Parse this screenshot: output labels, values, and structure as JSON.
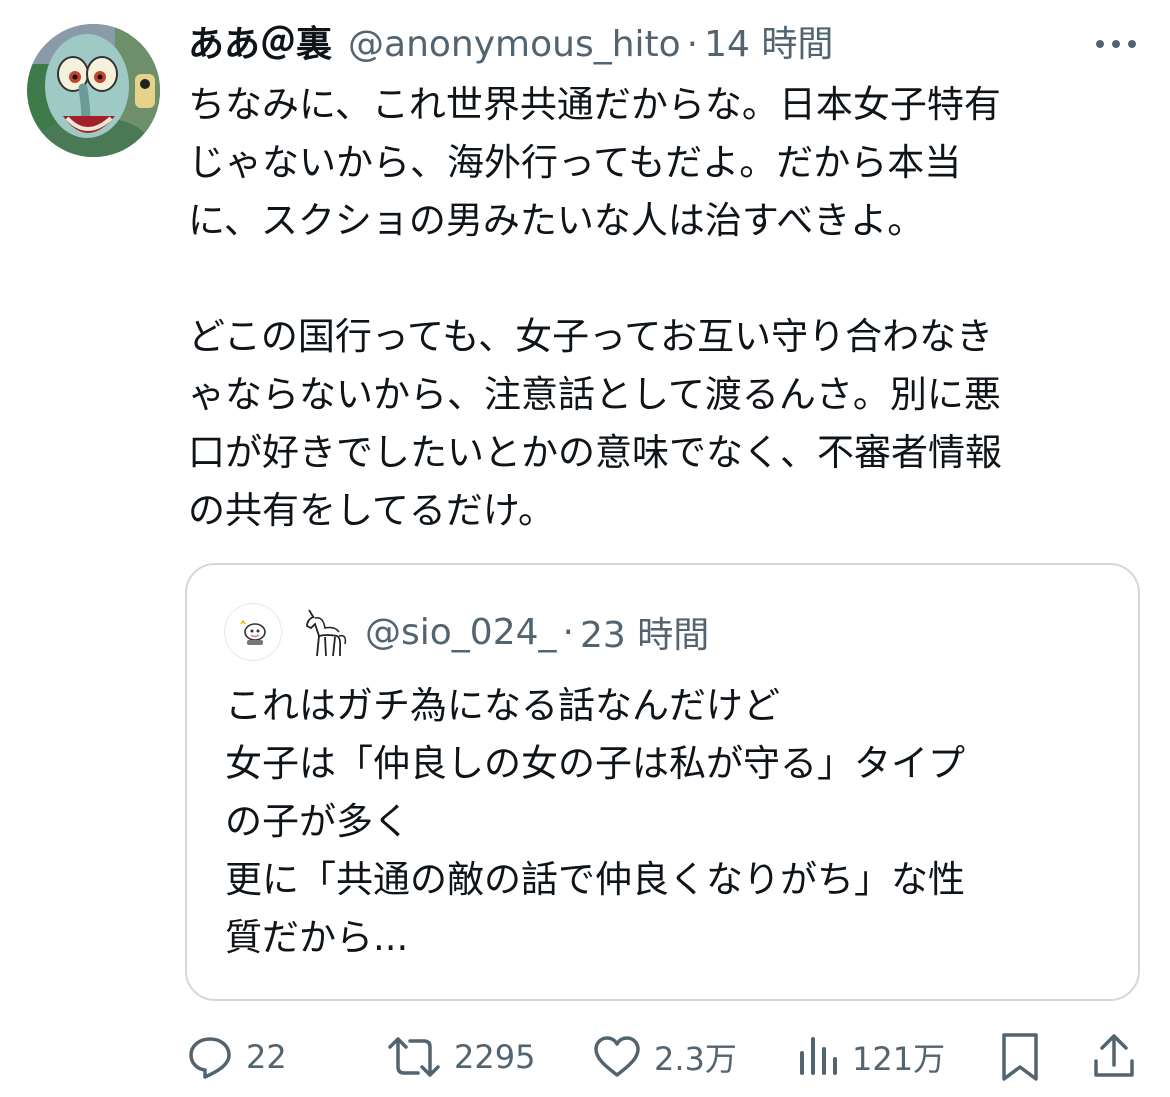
{
  "tweet": {
    "display_name": "ああ＠裏",
    "handle": "@anonymous_hito",
    "separator": "·",
    "time": "14 時間",
    "more_icon": "ellipsis-icon",
    "text": "ちなみに、これ世界共通だからな。日本女子特有\nじゃないから、海外行ってもだよ。だから本当\nに、スクショの男みたいな人は治すべきよ。\n\nどこの国行っても、女子ってお互い守り合わなき\nゃならないから、注意話として渡るんさ。別に悪\n口が好きでしたいとかの意味でなく、不審者情報\nの共有をしてるだけ。"
  },
  "quote": {
    "handle": "@sio_024_",
    "separator": "·",
    "time": "23 時間",
    "text": "これはガチ為になる話なんだけど\n女子は「仲良しの女の子は私が守る」タイプ\nの子が多く\n更に「共通の敵の話で仲良くなりがち」な性\n質だから..."
  },
  "actions": {
    "replies": "22",
    "retweets": "2295",
    "likes": "2.3万",
    "views": "121万"
  },
  "colors": {
    "text": "#0f1419",
    "secondary": "#536471",
    "border": "#cfd9de"
  }
}
